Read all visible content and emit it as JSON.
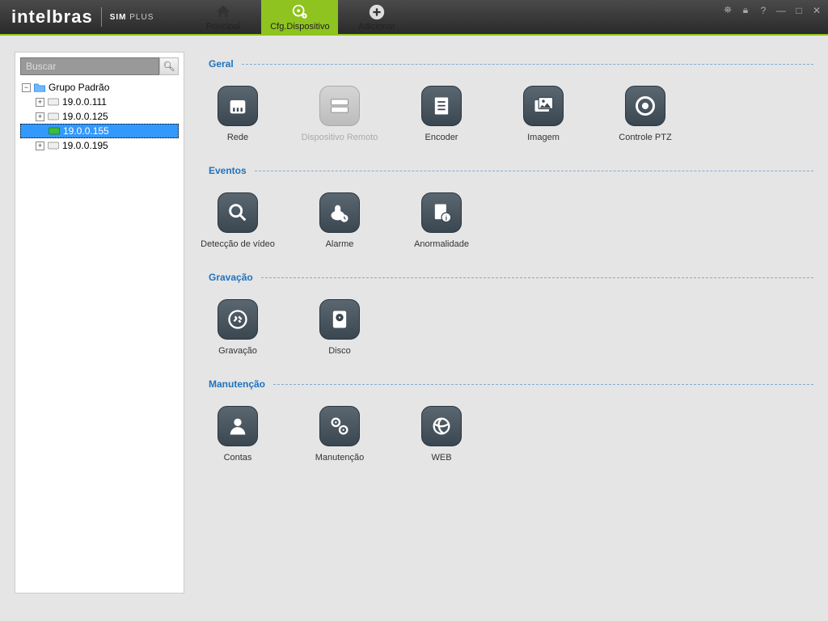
{
  "brand": {
    "name": "intelbras",
    "product_prefix": "SIM",
    "product_suffix": "PLUS"
  },
  "tabs": {
    "principal": "Principal",
    "cfg": "Cfg.Dispositivo",
    "adicionar": "Adicionar"
  },
  "sidebar": {
    "search_placeholder": "Buscar",
    "root_label": "Grupo Padrão",
    "nodes": [
      {
        "label": "19.0.0.111"
      },
      {
        "label": "19.0.0.125"
      },
      {
        "label": "19.0.0.155",
        "selected": true
      },
      {
        "label": "19.0.0.195"
      }
    ]
  },
  "sections": {
    "geral": {
      "title": "Geral",
      "items": {
        "rede": "Rede",
        "remoto": "Dispositivo Remoto",
        "encoder": "Encoder",
        "imagem": "Imagem",
        "ptz": "Controle PTZ"
      }
    },
    "eventos": {
      "title": "Eventos",
      "items": {
        "deteccao": "Detecção de vídeo",
        "alarme": "Alarme",
        "anormalidade": "Anormalidade"
      }
    },
    "gravacao": {
      "title": "Gravação",
      "items": {
        "gravacao": "Gravação",
        "disco": "Disco"
      }
    },
    "manutencao": {
      "title": "Manutenção",
      "items": {
        "contas": "Contas",
        "manutencao": "Manutenção",
        "web": "WEB"
      }
    }
  }
}
